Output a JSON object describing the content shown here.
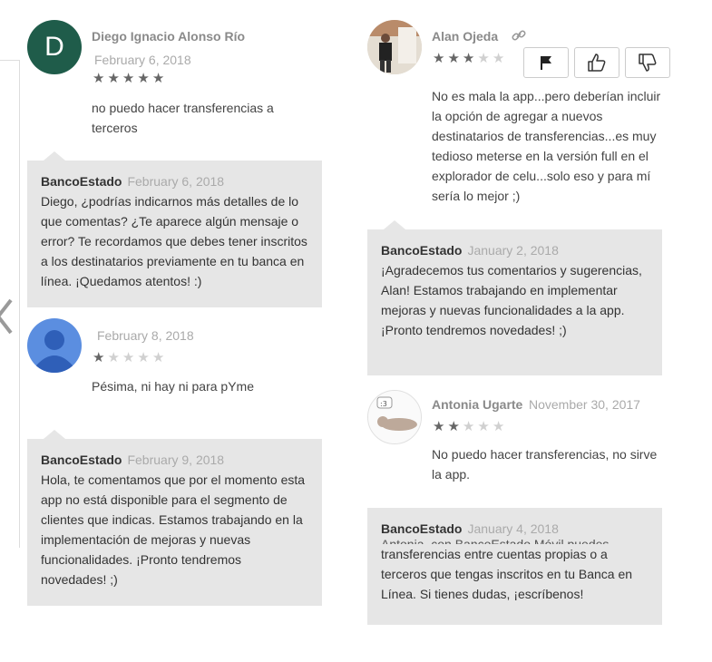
{
  "reviews_left": [
    {
      "avatar_letter": "D",
      "author": "Diego Ignacio Alonso Río",
      "date": "February 6, 2018",
      "rating": 5,
      "text": "no puedo hacer transferencias a terceros",
      "reply": {
        "author": "BancoEstado",
        "date": "February 6, 2018",
        "text": "Diego, ¿podrías indicarnos más detalles de lo que comentas? ¿Te aparece algún mensaje o error? Te recordamos que debes tener inscritos a los destinatarios previamente en tu banca en línea. ¡Quedamos atentos! :)"
      }
    },
    {
      "author": "",
      "date": "February 8, 2018",
      "rating": 1,
      "text": "Pésima, ni hay ni para pYme",
      "reply": {
        "author": "BancoEstado",
        "date": "February 9, 2018",
        "text": "Hola, te comentamos que por el momento esta app no está disponible para el segmento de clientes que indicas. Estamos trabajando en la implementación de mejoras y nuevas funcionalidades. ¡Pronto tendremos novedades! ;)"
      }
    }
  ],
  "reviews_right": [
    {
      "author": "Alan Ojeda",
      "date": "",
      "rating": 3,
      "text": "No es mala la app...pero deberían incluir la opción de agregar a nuevos destinatarios de transferencias...es muy tedioso meterse en la versión full en el explorador de celu...solo eso y para mí sería lo mejor ;)",
      "reply": {
        "author": "BancoEstado",
        "date": "January 2, 2018",
        "text": "¡Agradecemos tus comentarios y sugerencias, Alan! Estamos trabajando en implementar mejoras y nuevas funcionalidades a la app. ¡Pronto tendremos novedades! ;)"
      }
    },
    {
      "author": "Antonia Ugarte",
      "date": "November 30, 2017",
      "rating": 2,
      "text": "No puedo hacer transferencias, no sirve la app.",
      "reply": {
        "author": "BancoEstado",
        "date": "January 4, 2018",
        "text_cut": "Antonia, con BancoEstado Móvil puedes realizar",
        "text": "transferencias entre cuentas propias o a terceros que tengas inscritos en tu Banca en Línea. Si tienes dudas, ¡escríbenos!"
      }
    }
  ],
  "colors": {
    "avatar_d": "#1f5c4a",
    "avatar_default": "#5b8ee0",
    "reply_bg": "#e6e6e6",
    "star_on": "#666666",
    "star_off": "#d0d0d0"
  }
}
